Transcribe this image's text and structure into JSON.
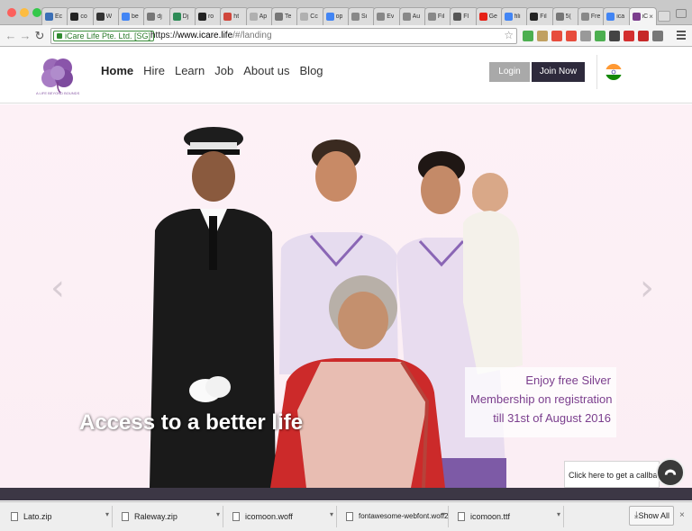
{
  "browser": {
    "tabs": [
      {
        "label": "Ec",
        "color": "#3b6fb6"
      },
      {
        "label": "co",
        "color": "#222222"
      },
      {
        "label": "W",
        "color": "#333333"
      },
      {
        "label": "be",
        "color": "#4285f4"
      },
      {
        "label": "dj",
        "color": "#777777"
      },
      {
        "label": "Dj",
        "color": "#2e8b57"
      },
      {
        "label": "ro",
        "color": "#222222"
      },
      {
        "label": "ht",
        "color": "#d0463b"
      },
      {
        "label": "Ap",
        "color": "#b0b0b0"
      },
      {
        "label": "Te",
        "color": "#777777"
      },
      {
        "label": "Cc",
        "color": "#b0b0b0"
      },
      {
        "label": "op",
        "color": "#4285f4"
      },
      {
        "label": "Si",
        "color": "#888888"
      },
      {
        "label": "Ev",
        "color": "#888888"
      },
      {
        "label": "Au",
        "color": "#888888"
      },
      {
        "label": "Fil",
        "color": "#888888"
      },
      {
        "label": "Fl",
        "color": "#555555"
      },
      {
        "label": "Ge",
        "color": "#e62117"
      },
      {
        "label": "fili",
        "color": "#4285f4"
      },
      {
        "label": "Fil",
        "color": "#222222"
      },
      {
        "label": "5(",
        "color": "#777777"
      },
      {
        "label": "Fre",
        "color": "#888888"
      },
      {
        "label": "ica",
        "color": "#4285f4"
      },
      {
        "label": "iC",
        "color": "#7b3e8d",
        "active": true
      }
    ],
    "tab_close": "×",
    "address": {
      "ev_label": "iCare Life Pte. Ltd. [SG]",
      "scheme": "https://",
      "host": "www.icare.life",
      "path": "/#/landing"
    },
    "extension_colors": [
      "#4caf50",
      "#c0a060",
      "#e74c3c",
      "#e74c3c",
      "#999999",
      "#4caf50",
      "#444444",
      "#d32f2f",
      "#c62828",
      "#777777"
    ]
  },
  "site": {
    "logo_text": "iCare Life",
    "logo_tagline": "A LIFE BEYOND BOUNDS",
    "nav": [
      "Home",
      "Hire",
      "Learn",
      "Job",
      "About us",
      "Blog"
    ],
    "login_label": "Login",
    "join_label": "Join Now"
  },
  "hero": {
    "tagline": "Access to a better life",
    "promo_lines": [
      "Enjoy free Silver",
      "Membership on registration",
      "till 31st of August 2016"
    ],
    "prev_arrow": "‹",
    "next_arrow": "›",
    "callback_label": "Click here to get a callback"
  },
  "downloads": {
    "items": [
      "Lato.zip",
      "Raleway.zip",
      "icomoon.woff",
      "fontawesome-webfont.woff2",
      "icomoon.ttf"
    ],
    "caret": "▾",
    "show_all": "Show All",
    "close": "×"
  },
  "colors": {
    "brand_purple": "#7b3e8d",
    "join_button": "#2e2a3c",
    "login_button": "#a9a9a9",
    "hero_bg": "#fbeef4"
  }
}
